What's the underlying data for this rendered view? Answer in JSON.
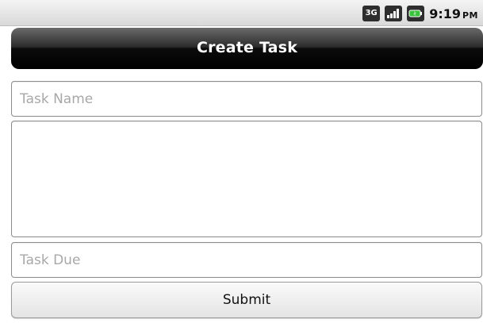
{
  "status_bar": {
    "network_label": "3G",
    "time": "9:19",
    "ampm": "PM",
    "icons": [
      "network-3g-icon",
      "signal-strength-icon",
      "battery-icon"
    ]
  },
  "title_bar": {
    "title": "Create Task"
  },
  "form": {
    "task_name": {
      "placeholder": "Task Name",
      "value": ""
    },
    "task_description": {
      "value": ""
    },
    "task_due": {
      "placeholder": "Task Due",
      "value": ""
    },
    "submit_label": "Submit"
  }
}
